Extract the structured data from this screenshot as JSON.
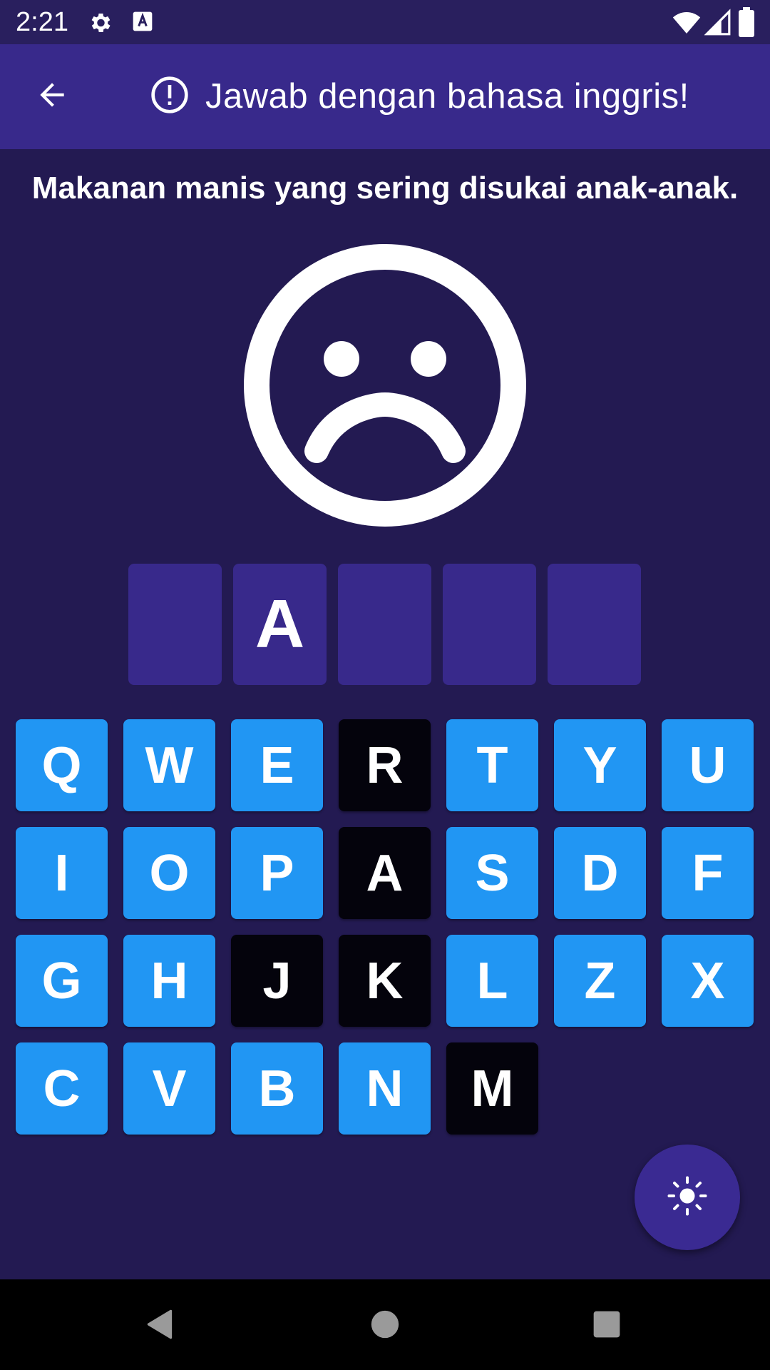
{
  "status_bar": {
    "time": "2:21",
    "icons": [
      "gear-icon",
      "font-a-icon",
      "wifi-icon",
      "signal-icon",
      "battery-icon"
    ]
  },
  "app_bar": {
    "back_icon": "arrow-back-icon",
    "info_icon": "alert-circle-icon",
    "title": "Jawab dengan bahasa inggris!",
    "color": "#38298b"
  },
  "clue": "Makanan manis yang sering disukai anak-anak.",
  "feedback_icon": "sad-face-icon",
  "answer": {
    "slots": [
      "",
      "A",
      "",
      "",
      ""
    ],
    "slot_color": "#38298b"
  },
  "keyboard": {
    "key_color": "#2196f3",
    "used_key_color": "#04030c",
    "rows": [
      [
        {
          "label": "Q",
          "used": false
        },
        {
          "label": "W",
          "used": false
        },
        {
          "label": "E",
          "used": false
        },
        {
          "label": "R",
          "used": true
        },
        {
          "label": "T",
          "used": false
        },
        {
          "label": "Y",
          "used": false
        },
        {
          "label": "U",
          "used": false
        }
      ],
      [
        {
          "label": "I",
          "used": false
        },
        {
          "label": "O",
          "used": false
        },
        {
          "label": "P",
          "used": false
        },
        {
          "label": "A",
          "used": true
        },
        {
          "label": "S",
          "used": false
        },
        {
          "label": "D",
          "used": false
        },
        {
          "label": "F",
          "used": false
        }
      ],
      [
        {
          "label": "G",
          "used": false
        },
        {
          "label": "H",
          "used": false
        },
        {
          "label": "J",
          "used": true
        },
        {
          "label": "K",
          "used": true
        },
        {
          "label": "L",
          "used": false
        },
        {
          "label": "Z",
          "used": false
        },
        {
          "label": "X",
          "used": false
        }
      ],
      [
        {
          "label": "C",
          "used": false
        },
        {
          "label": "V",
          "used": false
        },
        {
          "label": "B",
          "used": false
        },
        {
          "label": "N",
          "used": false
        },
        {
          "label": "M",
          "used": true
        }
      ]
    ]
  },
  "fab": {
    "icon": "brightness-icon"
  },
  "nav_bar": {
    "icons": [
      "nav-back-icon",
      "nav-home-icon",
      "nav-recents-icon"
    ]
  },
  "colors": {
    "background": "#231a52",
    "status_bar": "#291f5e"
  }
}
